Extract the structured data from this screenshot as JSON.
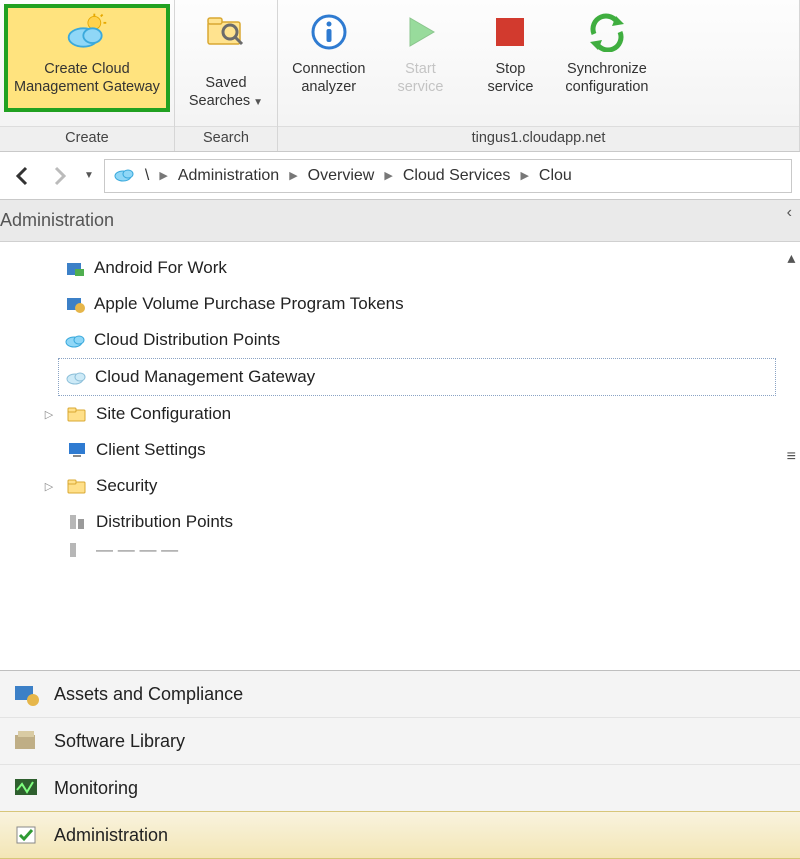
{
  "ribbon": {
    "groups": [
      {
        "title": "Create",
        "buttons": [
          {
            "label": "Create Cloud\nManagement Gateway",
            "icon": "cloud-sun-icon",
            "highlighted": true
          }
        ]
      },
      {
        "title": "Search",
        "buttons": [
          {
            "label": "Saved\nSearches",
            "icon": "search-folder-icon",
            "dropdown": true
          }
        ]
      },
      {
        "title": "tingus1.cloudapp.net",
        "buttons": [
          {
            "label": "Connection\nanalyzer",
            "icon": "info-icon"
          },
          {
            "label": "Start\nservice",
            "icon": "play-icon",
            "disabled": true
          },
          {
            "label": "Stop\nservice",
            "icon": "stop-icon"
          },
          {
            "label": "Synchronize\nconfiguration",
            "icon": "sync-icon"
          }
        ]
      }
    ]
  },
  "breadcrumb": {
    "items": [
      "Administration",
      "Overview",
      "Cloud Services",
      "Clou"
    ]
  },
  "panel_title": "Administration",
  "tree": {
    "items": [
      {
        "label": "Android For Work",
        "icon": "android-icon",
        "indent": 1
      },
      {
        "label": "Apple Volume Purchase Program Tokens",
        "icon": "apple-token-icon",
        "indent": 1
      },
      {
        "label": "Cloud Distribution Points",
        "icon": "cloud-icon",
        "indent": 1
      },
      {
        "label": "Cloud Management Gateway",
        "icon": "cloud-icon",
        "indent": 1,
        "selected": true
      },
      {
        "label": "Site Configuration",
        "icon": "folder-icon",
        "indent": 0,
        "expander": true
      },
      {
        "label": "Client Settings",
        "icon": "monitor-icon",
        "indent": 0
      },
      {
        "label": "Security",
        "icon": "folder-icon",
        "indent": 0,
        "expander": true
      },
      {
        "label": "Distribution Points",
        "icon": "server-icon",
        "indent": 0
      }
    ]
  },
  "workspaces": {
    "items": [
      {
        "label": "Assets and Compliance",
        "icon": "assets-icon"
      },
      {
        "label": "Software Library",
        "icon": "library-icon"
      },
      {
        "label": "Monitoring",
        "icon": "monitoring-icon"
      },
      {
        "label": "Administration",
        "icon": "admin-icon",
        "active": true
      }
    ]
  }
}
